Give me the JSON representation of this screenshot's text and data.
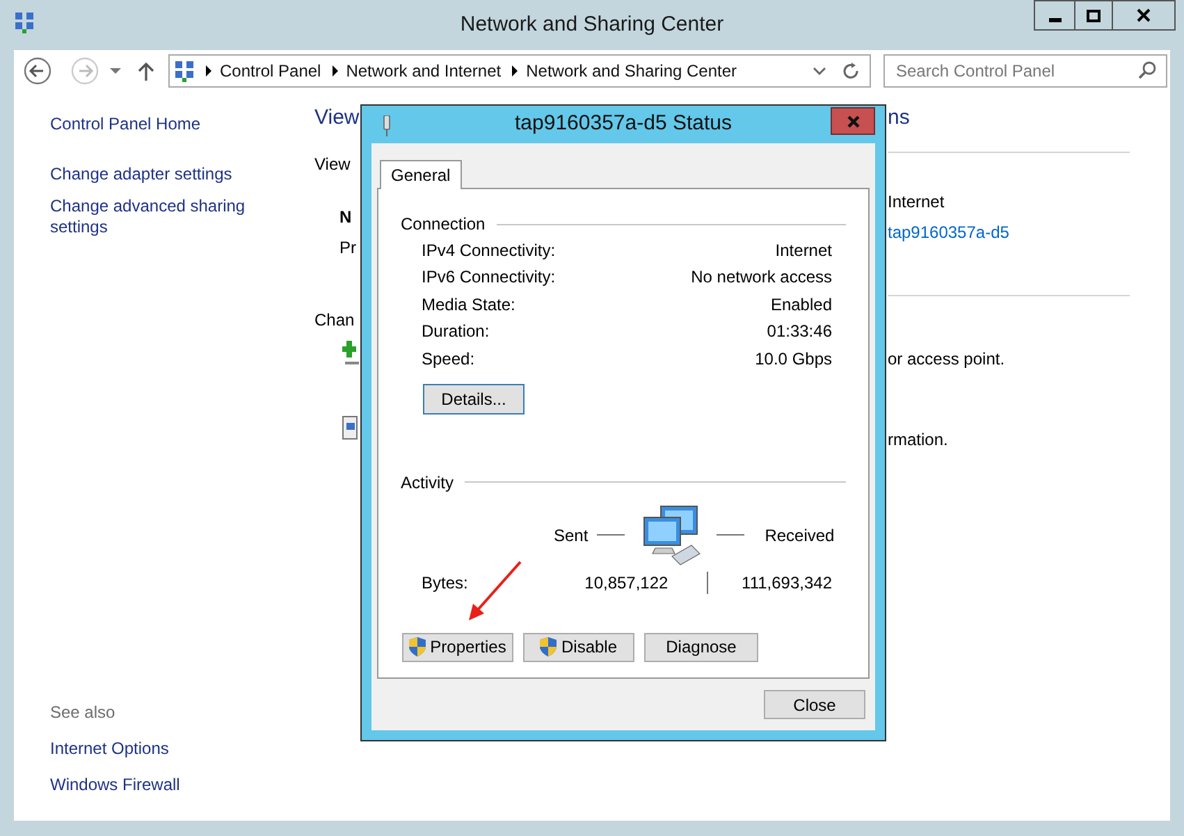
{
  "window": {
    "title": "Network and Sharing Center"
  },
  "nav": {
    "breadcrumb": [
      "Control Panel",
      "Network and Internet",
      "Network and Sharing Center"
    ],
    "search_placeholder": "Search Control Panel"
  },
  "sidebar": {
    "links": [
      "Control Panel Home",
      "Change adapter settings",
      "Change advanced sharing settings"
    ],
    "see_also_label": "See also",
    "see_also": [
      "Internet Options",
      "Windows Firewall"
    ]
  },
  "main_left": {
    "heading": "View",
    "subheading": "View",
    "network_name": "N",
    "network_type": "Pr",
    "change_heading": "Chan"
  },
  "main_right": {
    "heading": "ns",
    "access_type": "Internet",
    "connection_link": "tap9160357a-d5",
    "line_1": "or access point.",
    "line_2": "rmation."
  },
  "dialog": {
    "title": "tap9160357a-d5 Status",
    "tabs": [
      {
        "label": "General",
        "selected": true
      }
    ],
    "connection": {
      "label": "Connection",
      "rows": [
        {
          "label": "IPv4 Connectivity:",
          "value": "Internet"
        },
        {
          "label": "IPv6 Connectivity:",
          "value": "No network access"
        },
        {
          "label": "Media State:",
          "value": "Enabled"
        },
        {
          "label": "Duration:",
          "value": "01:33:46"
        },
        {
          "label": "Speed:",
          "value": "10.0 Gbps"
        }
      ],
      "details_button": "Details..."
    },
    "activity": {
      "label": "Activity",
      "sent_label": "Sent",
      "received_label": "Received",
      "bytes_label": "Bytes:",
      "sent": "10,857,122",
      "received": "111,693,342"
    },
    "buttons": [
      {
        "label": "Properties",
        "shield": true
      },
      {
        "label": "Disable",
        "shield": true
      },
      {
        "label": "Diagnose",
        "shield": false
      }
    ],
    "close_button": "Close"
  }
}
